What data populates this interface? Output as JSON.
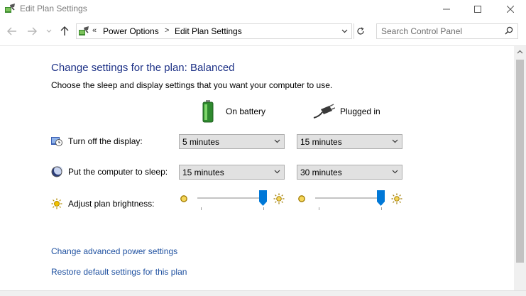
{
  "window": {
    "title": "Edit Plan Settings",
    "icons": [
      "power-options-icon",
      "minimize-icon",
      "maximize-icon",
      "close-icon"
    ]
  },
  "nav": {
    "icons": [
      "back-arrow-icon",
      "forward-arrow-icon",
      "recent-dropdown-icon",
      "up-arrow-icon"
    ]
  },
  "address": {
    "chevron": "«",
    "breadcrumb": [
      "Power Options",
      "Edit Plan Settings"
    ],
    "separator": ">"
  },
  "search": {
    "placeholder": "Search Control Panel"
  },
  "main": {
    "heading": "Change settings for the plan: Balanced",
    "subtext": "Choose the sleep and display settings that you want your computer to use.",
    "columns": {
      "battery": "On battery",
      "plugged": "Plugged in"
    },
    "rows": {
      "display": {
        "label": "Turn off the display:",
        "battery": "5 minutes",
        "plugged": "15 minutes"
      },
      "sleep": {
        "label": "Put the computer to sleep:",
        "battery": "15 minutes",
        "plugged": "30 minutes"
      },
      "brightness": {
        "label": "Adjust plan brightness:",
        "battery_level": 0.99,
        "plugged_level": 0.99
      }
    },
    "links": {
      "advanced": "Change advanced power settings",
      "restore": "Restore default settings for this plan"
    }
  },
  "colors": {
    "heading": "#1e3287",
    "link": "#1e50a0",
    "slider_thumb": "#0078d7"
  }
}
